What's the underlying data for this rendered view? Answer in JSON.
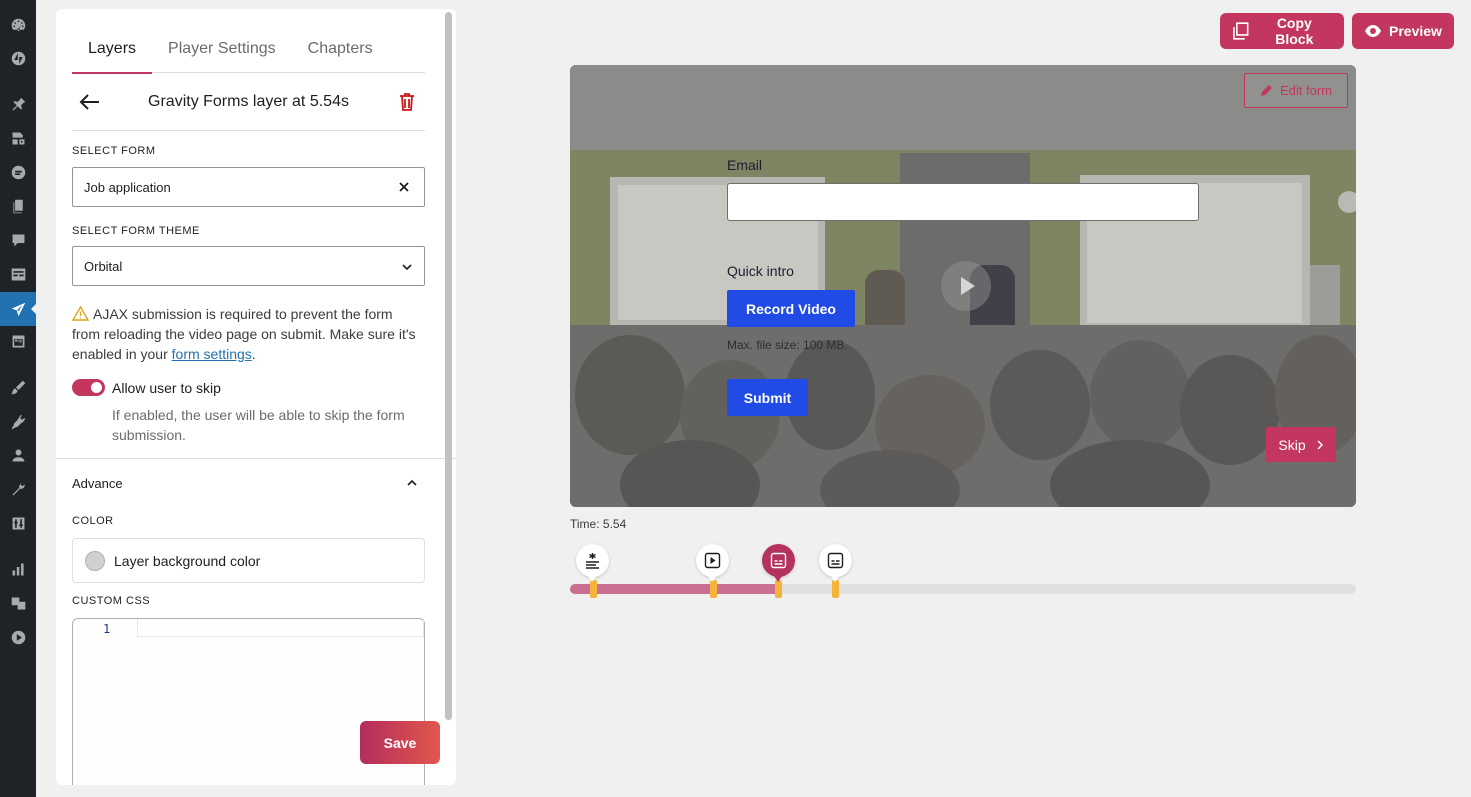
{
  "sidebar": {
    "icons": [
      "dashboard-icon",
      "jetpack-icon",
      "pin-icon",
      "media-icon",
      "feedback-icon",
      "pages-icon",
      "comments-icon",
      "forms-icon",
      "presto-player-icon",
      "calendar-icon",
      "appearance-icon",
      "plugins-icon",
      "users-icon",
      "tools-icon",
      "settings-icon",
      "analytics-icon",
      "translate-icon",
      "play-icon"
    ]
  },
  "panel": {
    "tabs": [
      "Layers",
      "Player Settings",
      "Chapters"
    ],
    "active_tab": "Layers",
    "layer_title": "Gravity Forms layer at 5.54s",
    "select_form_label": "SELECT FORM",
    "select_form_value": "Job application",
    "select_theme_label": "SELECT FORM THEME",
    "select_theme_value": "Orbital",
    "notice_text": "AJAX submission is required to prevent the form from reloading the video page on submit. Make sure it's enabled in your",
    "notice_link": "form settings",
    "notice_end": ".",
    "allow_skip_label": "Allow user to skip",
    "allow_skip_enabled": true,
    "allow_skip_help": "If enabled, the user will be able to skip the form submission.",
    "advance_label": "Advance",
    "color_label": "COLOR",
    "layer_bg_label": "Layer background color",
    "custom_css_label": "CUSTOM CSS",
    "css_line_number": "1",
    "save_label": "Save"
  },
  "toolbar": {
    "copy_block_label": "Copy Block",
    "preview_label": "Preview",
    "accent_color": "#c2365f"
  },
  "video": {
    "edit_form_label": "Edit form",
    "email_label": "Email",
    "quick_intro_label": "Quick intro",
    "record_video_label": "Record Video",
    "max_file_note": "Max. file size: 100 MB.",
    "submit_label": "Submit",
    "skip_label": "Skip"
  },
  "timeline": {
    "time_text": "Time: 5.54",
    "markers": [
      "text-layer-icon",
      "play-layer-icon",
      "form-layer-icon",
      "form-layer-icon"
    ],
    "selected_marker_index": 2
  }
}
